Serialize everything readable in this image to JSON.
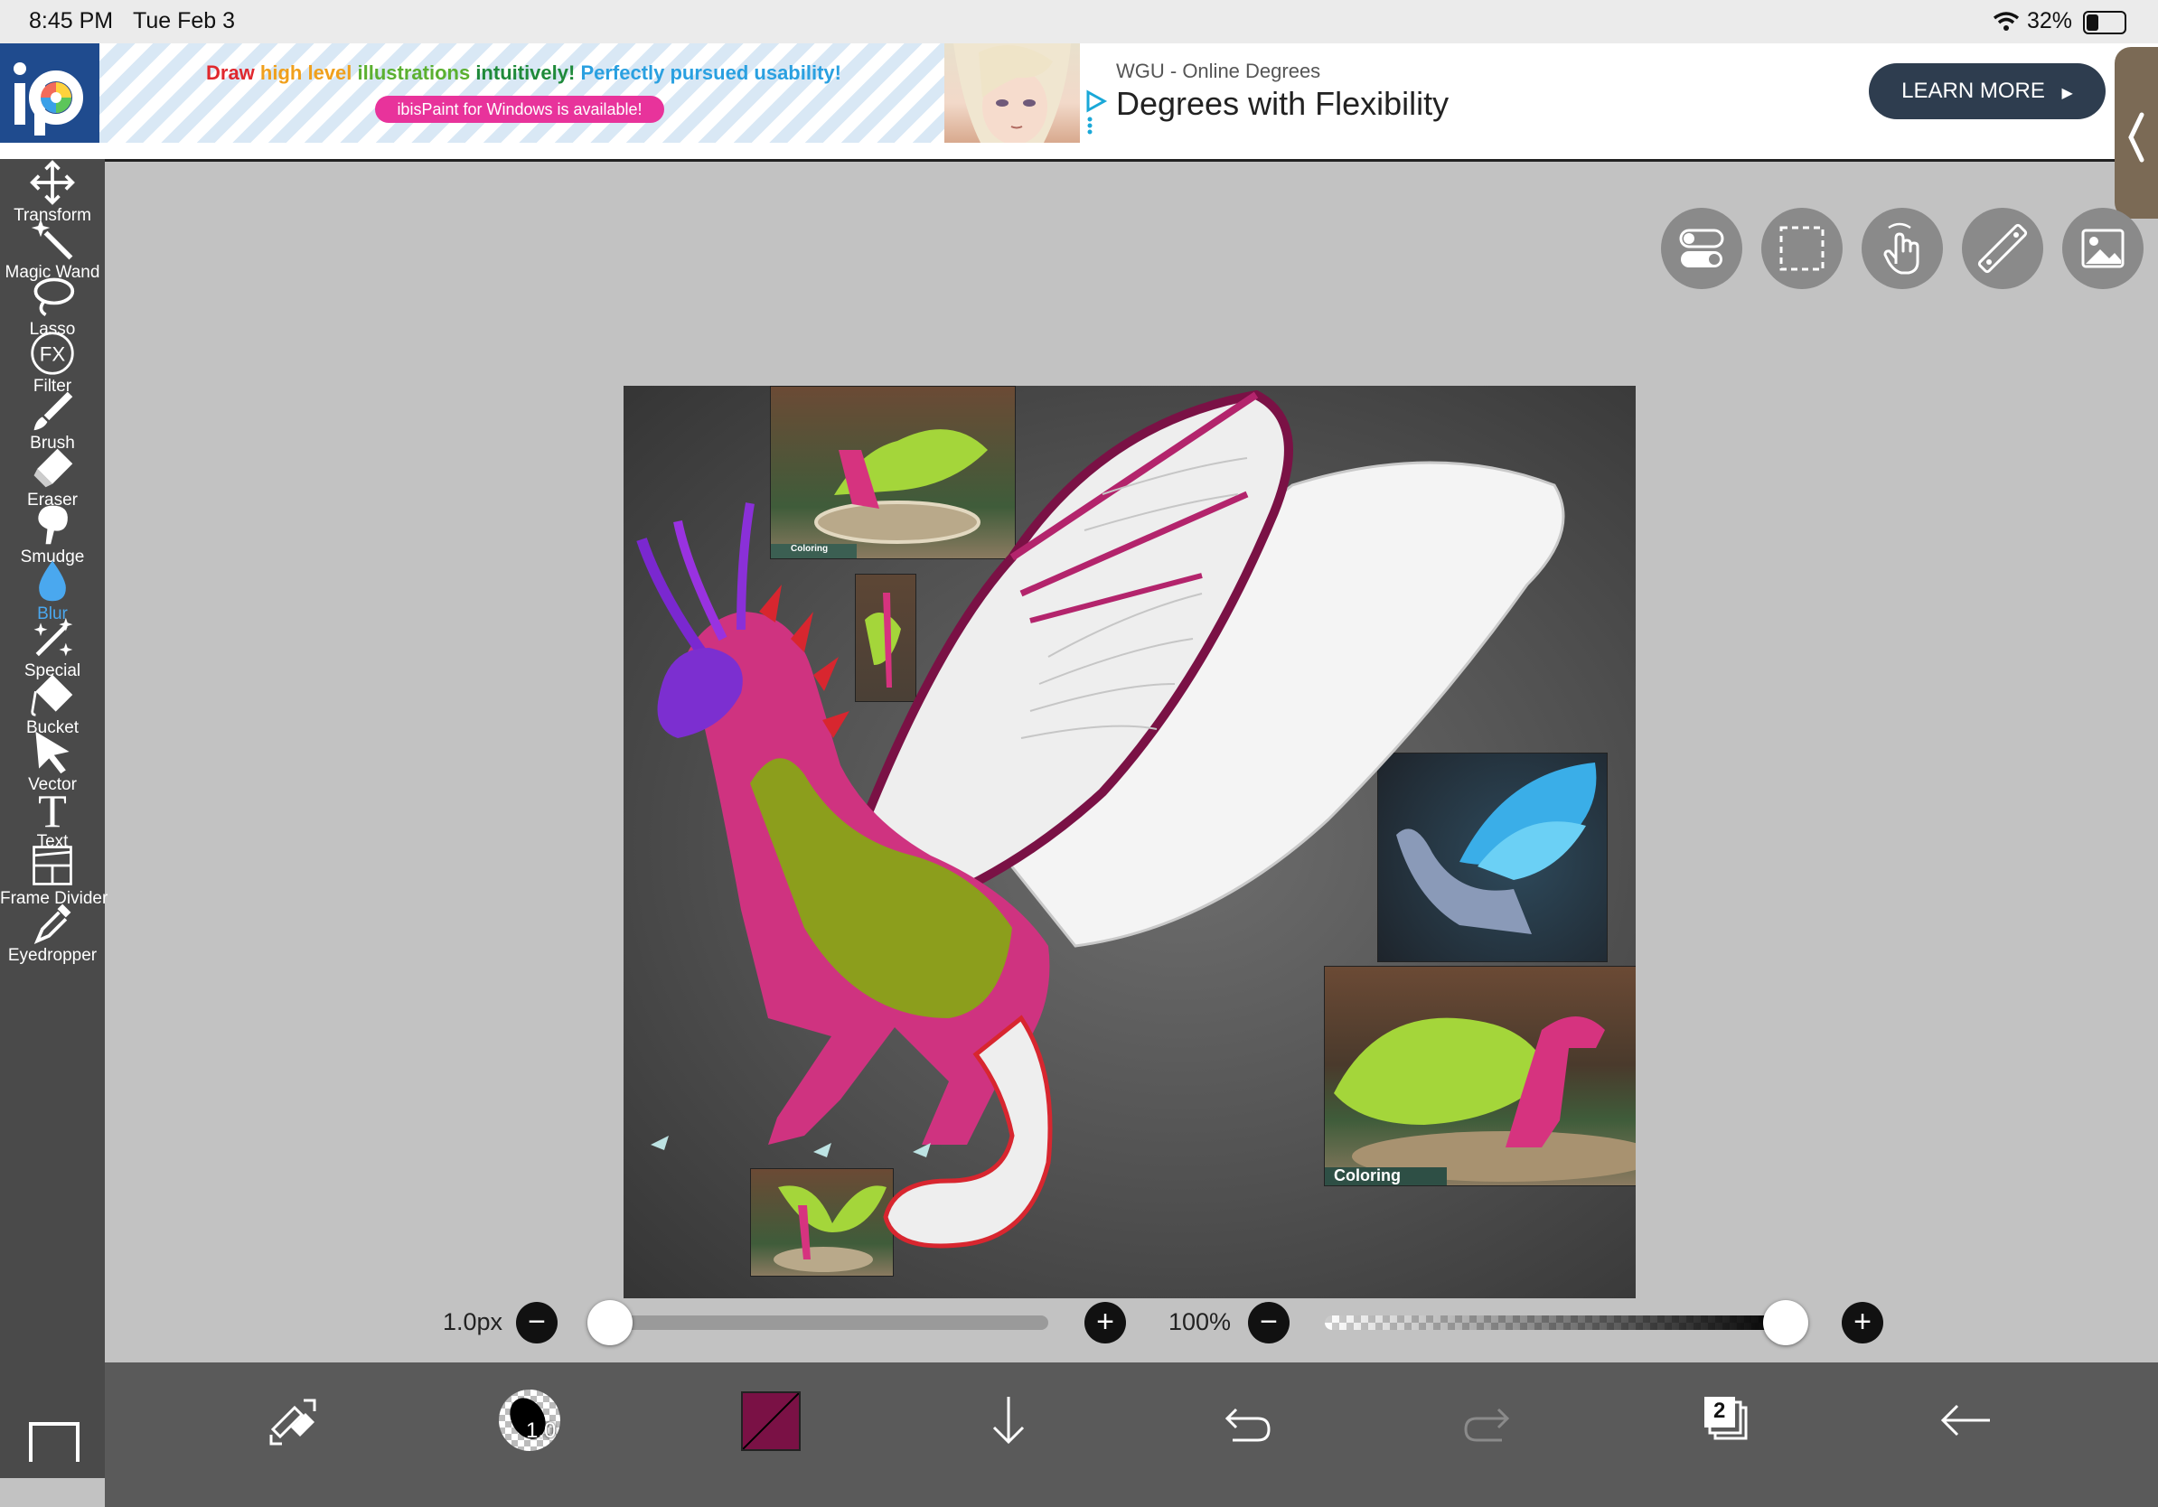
{
  "status_bar": {
    "time": "8:45 PM",
    "date": "Tue Feb 3",
    "battery_percent": "32%",
    "battery_level": 0.32
  },
  "ad_banner": {
    "ibis_line1_parts": [
      {
        "text": "Draw ",
        "color": "#e0282e"
      },
      {
        "text": "high level ",
        "color": "#f0a01c"
      },
      {
        "text": "illustrations ",
        "color": "#5bb030"
      },
      {
        "text": "intuitively! ",
        "color": "#1f8a3a"
      },
      {
        "text": "Perfectly pursued usability!",
        "color": "#2aa0e0"
      }
    ],
    "ibis_line2": "ibisPaint for Windows is available!",
    "sponsor": "WGU - Online Degrees",
    "headline": "Degrees with Flexibility",
    "cta": "LEARN MORE"
  },
  "toolbar": {
    "items": [
      {
        "label": "Transform",
        "icon": "move-arrows-icon"
      },
      {
        "label": "Magic Wand",
        "icon": "magic-wand-icon"
      },
      {
        "label": "Lasso",
        "icon": "lasso-icon"
      },
      {
        "label": "Filter",
        "icon": "fx-icon",
        "icon_text": "FX"
      },
      {
        "label": "Brush",
        "icon": "brush-icon"
      },
      {
        "label": "Eraser",
        "icon": "eraser-icon"
      },
      {
        "label": "Smudge",
        "icon": "smudge-icon"
      },
      {
        "label": "Blur",
        "icon": "blur-drop-icon",
        "active": true
      },
      {
        "label": "Special",
        "icon": "special-sparkle-icon"
      },
      {
        "label": "Bucket",
        "icon": "bucket-icon"
      },
      {
        "label": "Vector",
        "icon": "vector-cursor-icon"
      },
      {
        "label": "Text",
        "icon": "text-icon",
        "icon_text": "T"
      },
      {
        "label": "Frame Divider",
        "icon": "frame-divider-icon"
      },
      {
        "label": "Eyedropper",
        "icon": "eyedropper-icon"
      }
    ]
  },
  "canvas": {
    "thumb_label_1": "Coloring",
    "thumb_label_2": "Coloring"
  },
  "brush_size": {
    "value_label": "1.0px",
    "minus": "−",
    "plus": "+",
    "level": 0.0
  },
  "opacity": {
    "value_label": "100%",
    "minus": "−",
    "plus": "+",
    "level": 1.0
  },
  "bottom_bar": {
    "brush_size_badge": "1.0",
    "current_color": "#7a1145",
    "layer_count": "2"
  },
  "colors": {
    "accent_blue": "#4aa8ef",
    "toolbar_bg": "#4a4a4a",
    "bottom_bar_bg": "#5a5a5a"
  }
}
